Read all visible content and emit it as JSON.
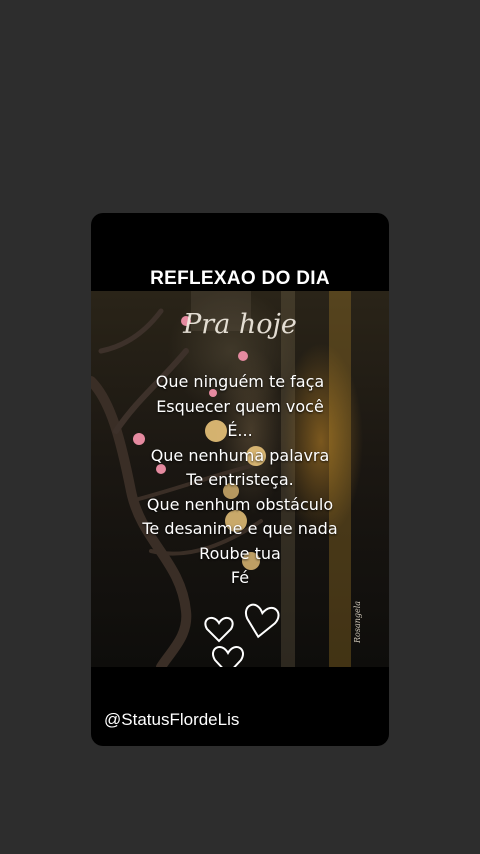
{
  "card": {
    "title": "REFLEXAO DO DIA",
    "script_heading": "Pra hoje",
    "poem_lines": [
      "Que ninguém te faça",
      "Esquecer quem você",
      "É...",
      "Que nenhuma palavra",
      "Te entristeça.",
      "Que nenhum obstáculo",
      "Te desanime e que nada",
      "Roube tua",
      "Fé"
    ],
    "signature": "Rosangela",
    "handle": "@StatusFlordeLis"
  },
  "colors": {
    "page_background": "#2d2d2d",
    "card_background": "#000000",
    "text": "#ffffff",
    "blossom_pink": "#e58aa0",
    "blossom_yellow": "#e9c37a"
  }
}
